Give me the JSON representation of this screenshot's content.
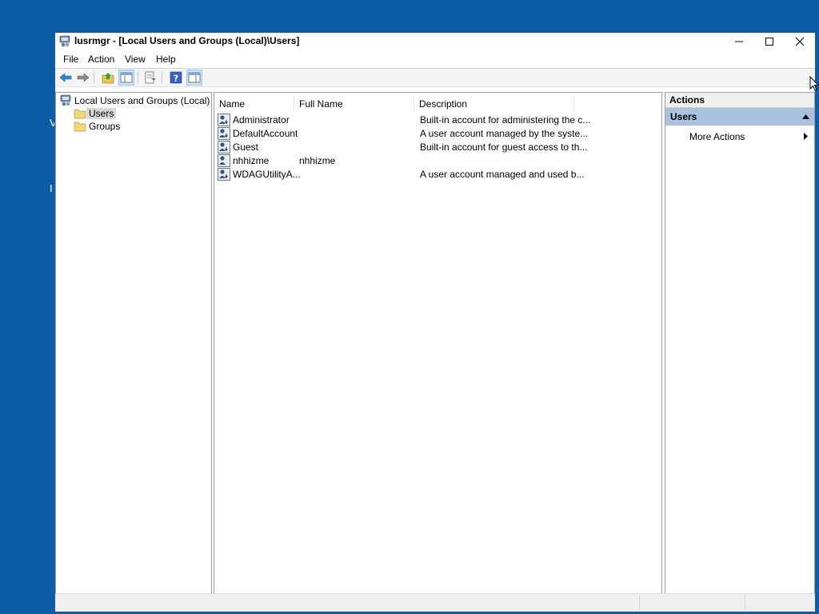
{
  "window": {
    "title": "lusrmgr - [Local Users and Groups (Local)\\Users]"
  },
  "menu": [
    "File",
    "Action",
    "View",
    "Help"
  ],
  "tree": {
    "root": "Local Users and Groups (Local)",
    "children": [
      "Users",
      "Groups"
    ],
    "selected": "Users"
  },
  "list": {
    "columns": [
      "Name",
      "Full Name",
      "Description"
    ],
    "rows": [
      {
        "name": "Administrator",
        "full_name": "",
        "description": "Built-in account for administering the c..."
      },
      {
        "name": "DefaultAccount",
        "full_name": "",
        "description": "A user account managed by the syste..."
      },
      {
        "name": "Guest",
        "full_name": "",
        "description": "Built-in account for guest access to th..."
      },
      {
        "name": "nhhizme",
        "full_name": "nhhizme",
        "description": ""
      },
      {
        "name": "WDAGUtilityA...",
        "full_name": "",
        "description": "A user account managed and used b..."
      }
    ]
  },
  "actions": {
    "header": "Actions",
    "section": "Users",
    "items": [
      "More Actions"
    ]
  },
  "colors": {
    "desktop": "#0d5da6",
    "actions_section": "#a8c2e0",
    "selection": "#d9d9d9"
  }
}
